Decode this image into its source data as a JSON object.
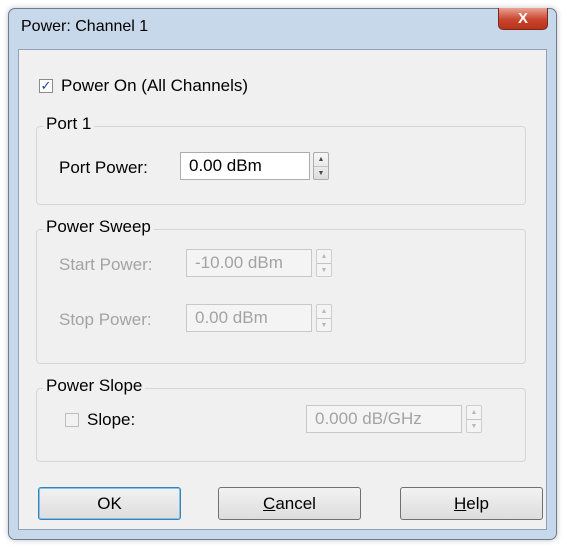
{
  "window": {
    "title": "Power: Channel 1",
    "close_glyph": "X"
  },
  "power_on": {
    "label": "Power On (All Channels)",
    "checked": true
  },
  "port1": {
    "title": "Port 1",
    "port_power_label": "Port Power:",
    "port_power_value": "0.00 dBm"
  },
  "power_sweep": {
    "title": "Power Sweep",
    "start_label": "Start Power:",
    "start_value": "-10.00 dBm",
    "stop_label": "Stop Power:",
    "stop_value": "0.00 dBm"
  },
  "power_slope": {
    "title": "Power Slope",
    "slope_label": "Slope:",
    "slope_checked": false,
    "slope_value": "0.000 dB/GHz"
  },
  "buttons": {
    "ok": "OK",
    "cancel_first": "C",
    "cancel_rest": "ancel",
    "help_first": "H",
    "help_rest": "elp"
  },
  "icons": {
    "check": "✓",
    "spin_up": "▲",
    "spin_down": "▼"
  },
  "colors": {
    "frame": "#c7d8ea",
    "close_button": "#c9452e",
    "default_button_border": "#3c7fb1"
  }
}
